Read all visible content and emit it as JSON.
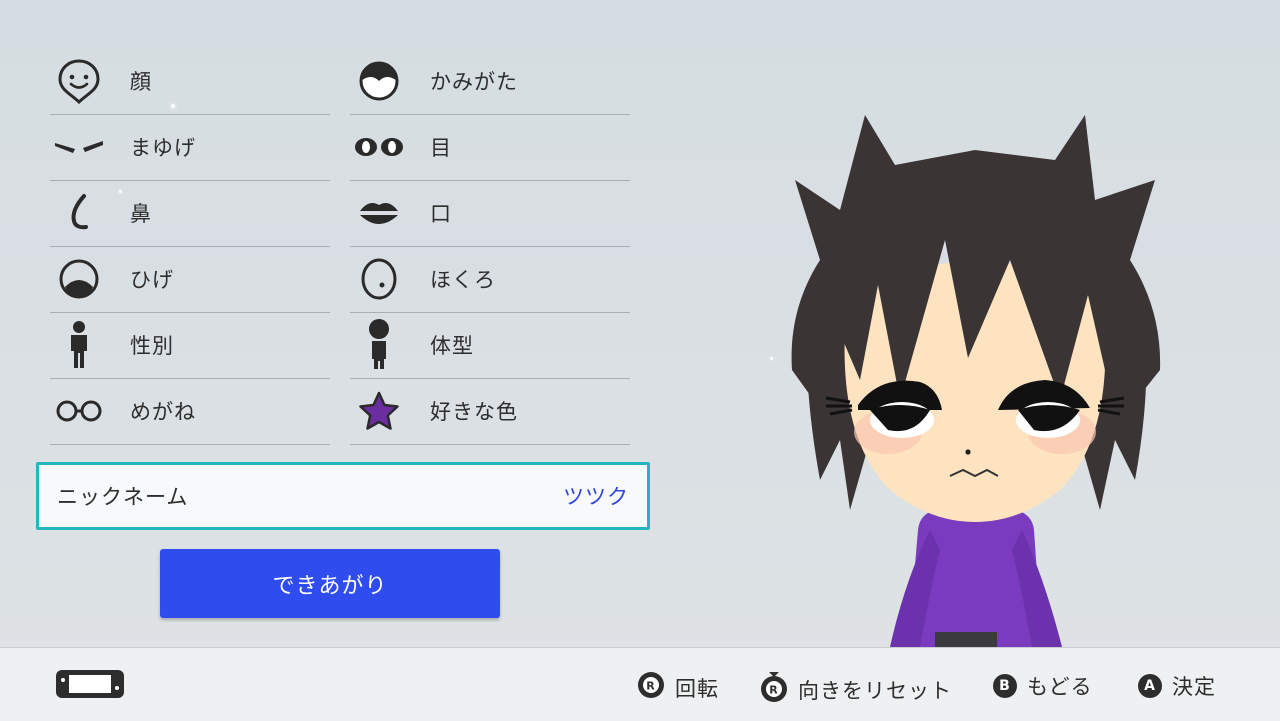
{
  "menu": {
    "left": [
      {
        "label": "顔",
        "icon": "face-icon"
      },
      {
        "label": "まゆげ",
        "icon": "eyebrows-icon"
      },
      {
        "label": "鼻",
        "icon": "nose-icon"
      },
      {
        "label": "ひげ",
        "icon": "beard-icon"
      },
      {
        "label": "性別",
        "icon": "gender-icon"
      },
      {
        "label": "めがね",
        "icon": "glasses-icon"
      }
    ],
    "right": [
      {
        "label": "かみがた",
        "icon": "hairstyle-icon"
      },
      {
        "label": "目",
        "icon": "eyes-icon"
      },
      {
        "label": "口",
        "icon": "mouth-icon"
      },
      {
        "label": "ほくろ",
        "icon": "mole-icon"
      },
      {
        "label": "体型",
        "icon": "body-icon"
      },
      {
        "label": "好きな色",
        "icon": "favorite-color-star-icon"
      }
    ]
  },
  "nickname": {
    "label": "ニックネーム",
    "value": "ツツク"
  },
  "done_button": {
    "label": "できあがり"
  },
  "footer": {
    "hints": [
      {
        "button": "R",
        "label": "回転",
        "icon": "right-stick-icon"
      },
      {
        "button": "R",
        "label": "向きをリセット",
        "icon": "right-stick-press-icon"
      },
      {
        "button": "B",
        "label": "もどる",
        "icon": "b-button-icon"
      },
      {
        "button": "A",
        "label": "決定",
        "icon": "a-button-icon"
      }
    ]
  },
  "colors": {
    "accent_border": "#22b7bf",
    "primary_button": "#2f4cef",
    "favorite_color": "#6a2ea0",
    "shirt": "#7a3bbf"
  }
}
